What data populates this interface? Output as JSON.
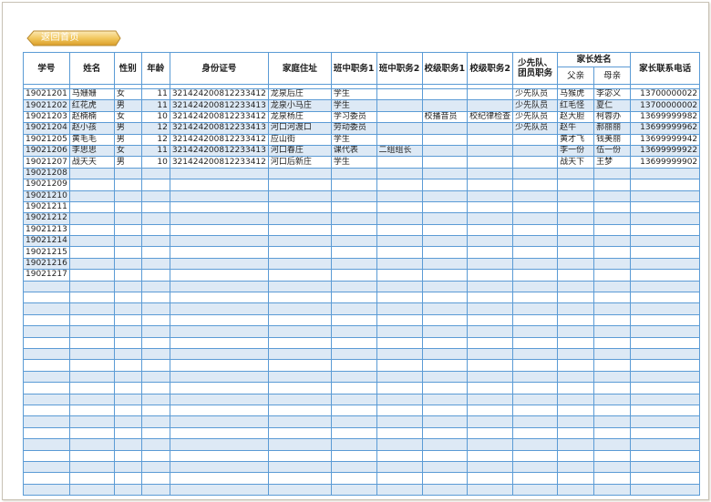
{
  "back_button": {
    "label": "返回首页"
  },
  "table": {
    "headers": {
      "student_id": "学号",
      "name": "姓名",
      "gender": "性别",
      "age": "年龄",
      "id_number": "身份证号",
      "address": "家庭住址",
      "class_duty_1": "班中职务1",
      "class_duty_2": "班中职务2",
      "school_duty_1": "校级职务1",
      "school_duty_2": "校级职务2",
      "pioneer": "少先队、团员职务",
      "parent_name": "家长姓名",
      "father": "父亲",
      "mother": "母亲",
      "parent_phone": "家长联系电话"
    },
    "rows": [
      [
        "19021201",
        "马姗姗",
        "女",
        "11",
        "321424200812233412",
        "龙泉后庄",
        "学生",
        "",
        "",
        "",
        "少先队员",
        "马猴虎",
        "李宓义",
        "13700000022"
      ],
      [
        "19021202",
        "红花虎",
        "男",
        "11",
        "321424200812233413",
        "龙泉小马庄",
        "学生",
        "",
        "",
        "",
        "少先队员",
        "红毛怪",
        "夏仁",
        "13700000002"
      ],
      [
        "19021203",
        "赵楠楠",
        "女",
        "10",
        "321424200812233412",
        "龙泉杨庄",
        "学习委员",
        "",
        "校播音员",
        "校纪律检查",
        "少先队员",
        "赵大胆",
        "柯蓉办",
        "13699999982"
      ],
      [
        "19021204",
        "赵小孩",
        "男",
        "12",
        "321424200812233413",
        "河口河渡口",
        "劳动委员",
        "",
        "",
        "",
        "少先队员",
        "赵牛",
        "郝丽丽",
        "13699999962"
      ],
      [
        "19021205",
        "黄毛毛",
        "男",
        "12",
        "321424200812233412",
        "应山街",
        "学生",
        "",
        "",
        "",
        "",
        "黄才飞",
        "钱美丽",
        "13699999942"
      ],
      [
        "19021206",
        "李思思",
        "女",
        "11",
        "321424200812233413",
        "河口春庄",
        "课代表",
        "二组组长",
        "",
        "",
        "",
        "李一份",
        "伍一份",
        "13699999922"
      ],
      [
        "19021207",
        "战天天",
        "男",
        "10",
        "321424200812233412",
        "河口后新庄",
        "学生",
        "",
        "",
        "",
        "",
        "战天下",
        "王梦",
        "13699999902"
      ],
      [
        "19021208",
        "",
        "",
        "",
        "",
        "",
        "",
        "",
        "",
        "",
        "",
        "",
        "",
        ""
      ],
      [
        "19021209",
        "",
        "",
        "",
        "",
        "",
        "",
        "",
        "",
        "",
        "",
        "",
        "",
        ""
      ],
      [
        "19021210",
        "",
        "",
        "",
        "",
        "",
        "",
        "",
        "",
        "",
        "",
        "",
        "",
        ""
      ],
      [
        "19021211",
        "",
        "",
        "",
        "",
        "",
        "",
        "",
        "",
        "",
        "",
        "",
        "",
        ""
      ],
      [
        "19021212",
        "",
        "",
        "",
        "",
        "",
        "",
        "",
        "",
        "",
        "",
        "",
        "",
        ""
      ],
      [
        "19021213",
        "",
        "",
        "",
        "",
        "",
        "",
        "",
        "",
        "",
        "",
        "",
        "",
        ""
      ],
      [
        "19021214",
        "",
        "",
        "",
        "",
        "",
        "",
        "",
        "",
        "",
        "",
        "",
        "",
        ""
      ],
      [
        "19021215",
        "",
        "",
        "",
        "",
        "",
        "",
        "",
        "",
        "",
        "",
        "",
        "",
        ""
      ],
      [
        "19021216",
        "",
        "",
        "",
        "",
        "",
        "",
        "",
        "",
        "",
        "",
        "",
        "",
        ""
      ],
      [
        "19021217",
        "",
        "",
        "",
        "",
        "",
        "",
        "",
        "",
        "",
        "",
        "",
        "",
        ""
      ],
      [
        "",
        "",
        "",
        "",
        "",
        "",
        "",
        "",
        "",
        "",
        "",
        "",
        "",
        ""
      ],
      [
        "",
        "",
        "",
        "",
        "",
        "",
        "",
        "",
        "",
        "",
        "",
        "",
        "",
        ""
      ],
      [
        "",
        "",
        "",
        "",
        "",
        "",
        "",
        "",
        "",
        "",
        "",
        "",
        "",
        ""
      ],
      [
        "",
        "",
        "",
        "",
        "",
        "",
        "",
        "",
        "",
        "",
        "",
        "",
        "",
        ""
      ],
      [
        "",
        "",
        "",
        "",
        "",
        "",
        "",
        "",
        "",
        "",
        "",
        "",
        "",
        ""
      ],
      [
        "",
        "",
        "",
        "",
        "",
        "",
        "",
        "",
        "",
        "",
        "",
        "",
        "",
        ""
      ],
      [
        "",
        "",
        "",
        "",
        "",
        "",
        "",
        "",
        "",
        "",
        "",
        "",
        "",
        ""
      ],
      [
        "",
        "",
        "",
        "",
        "",
        "",
        "",
        "",
        "",
        "",
        "",
        "",
        "",
        ""
      ],
      [
        "",
        "",
        "",
        "",
        "",
        "",
        "",
        "",
        "",
        "",
        "",
        "",
        "",
        ""
      ],
      [
        "",
        "",
        "",
        "",
        "",
        "",
        "",
        "",
        "",
        "",
        "",
        "",
        "",
        ""
      ],
      [
        "",
        "",
        "",
        "",
        "",
        "",
        "",
        "",
        "",
        "",
        "",
        "",
        "",
        ""
      ],
      [
        "",
        "",
        "",
        "",
        "",
        "",
        "",
        "",
        "",
        "",
        "",
        "",
        "",
        ""
      ],
      [
        "",
        "",
        "",
        "",
        "",
        "",
        "",
        "",
        "",
        "",
        "",
        "",
        "",
        ""
      ],
      [
        "",
        "",
        "",
        "",
        "",
        "",
        "",
        "",
        "",
        "",
        "",
        "",
        "",
        ""
      ],
      [
        "",
        "",
        "",
        "",
        "",
        "",
        "",
        "",
        "",
        "",
        "",
        "",
        "",
        ""
      ],
      [
        "",
        "",
        "",
        "",
        "",
        "",
        "",
        "",
        "",
        "",
        "",
        "",
        "",
        ""
      ],
      [
        "",
        "",
        "",
        "",
        "",
        "",
        "",
        "",
        "",
        "",
        "",
        "",
        "",
        ""
      ],
      [
        "",
        "",
        "",
        "",
        "",
        "",
        "",
        "",
        "",
        "",
        "",
        "",
        "",
        ""
      ],
      [
        "",
        "",
        "",
        "",
        "",
        "",
        "",
        "",
        "",
        "",
        "",
        "",
        "",
        ""
      ]
    ]
  },
  "colors": {
    "grid": "#5b9bd5",
    "band": "#dde9f5",
    "button": "#e8b84a"
  }
}
